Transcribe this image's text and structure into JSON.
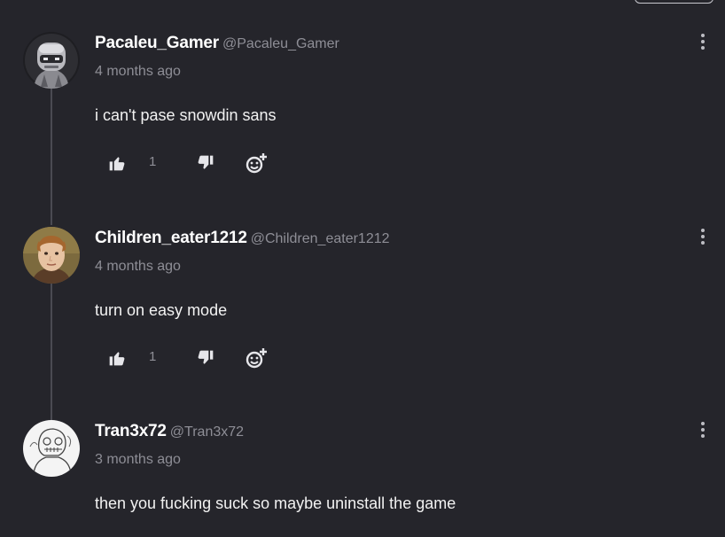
{
  "comments": [
    {
      "username": "Pacaleu_Gamer",
      "handle": "@Pacaleu_Gamer",
      "time": "4 months ago",
      "text": "i can't pase snowdin sans",
      "likes": "1",
      "avatar": "robot-helmet-avatar"
    },
    {
      "username": "Children_eater1212",
      "handle": "@Children_eater1212",
      "time": "4 months ago",
      "text": "turn on easy mode",
      "likes": "1",
      "avatar": "child-photo-avatar"
    },
    {
      "username": "Tran3x72",
      "handle": "@Tran3x72",
      "time": "3 months ago",
      "text": "then you fucking suck so maybe uninstall the game",
      "avatar": "sketch-skull-avatar"
    }
  ],
  "icons": {
    "like": "thumbs-up-icon",
    "dislike": "thumbs-down-icon",
    "react": "add-reaction-icon",
    "more": "more-options-icon"
  },
  "colors": {
    "background": "#25252b",
    "muted_text": "#8e8e96",
    "thread_line": "#4a4a52"
  }
}
